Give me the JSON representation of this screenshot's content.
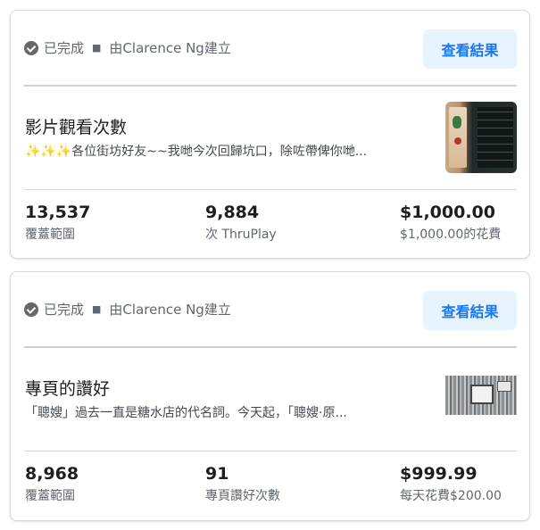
{
  "cards": [
    {
      "status": "已完成",
      "creator": "由Clarence Ng建立",
      "view_button": "查看結果",
      "title": "影片觀看次數",
      "description": "✨✨✨各位街坊好友~~我哋今次回歸坑口，除咗帶俾你哋...",
      "thumbnail": "video-thumbnail",
      "metrics": [
        {
          "value": "13,537",
          "label": "覆蓋範圍"
        },
        {
          "value": "9,884",
          "label": "次 ThruPlay"
        },
        {
          "value": "$1,000.00",
          "label": "$1,000.00的花費"
        }
      ]
    },
    {
      "status": "已完成",
      "creator": "由Clarence Ng建立",
      "view_button": "查看結果",
      "title": "專頁的讚好",
      "description": "「聰嫂」過去一直是糖水店的代名詞。今天起，「聰嫂·原...",
      "thumbnail": "storefront-thumbnail",
      "metrics": [
        {
          "value": "8,968",
          "label": "覆蓋範圍"
        },
        {
          "value": "91",
          "label": "專頁讚好次數"
        },
        {
          "value": "$999.99",
          "label": "每天花費$200.00"
        }
      ]
    }
  ],
  "colors": {
    "accent": "#1877f2",
    "button_bg": "#e7f3ff",
    "muted_text": "#606770",
    "border": "#d6d9dd"
  }
}
